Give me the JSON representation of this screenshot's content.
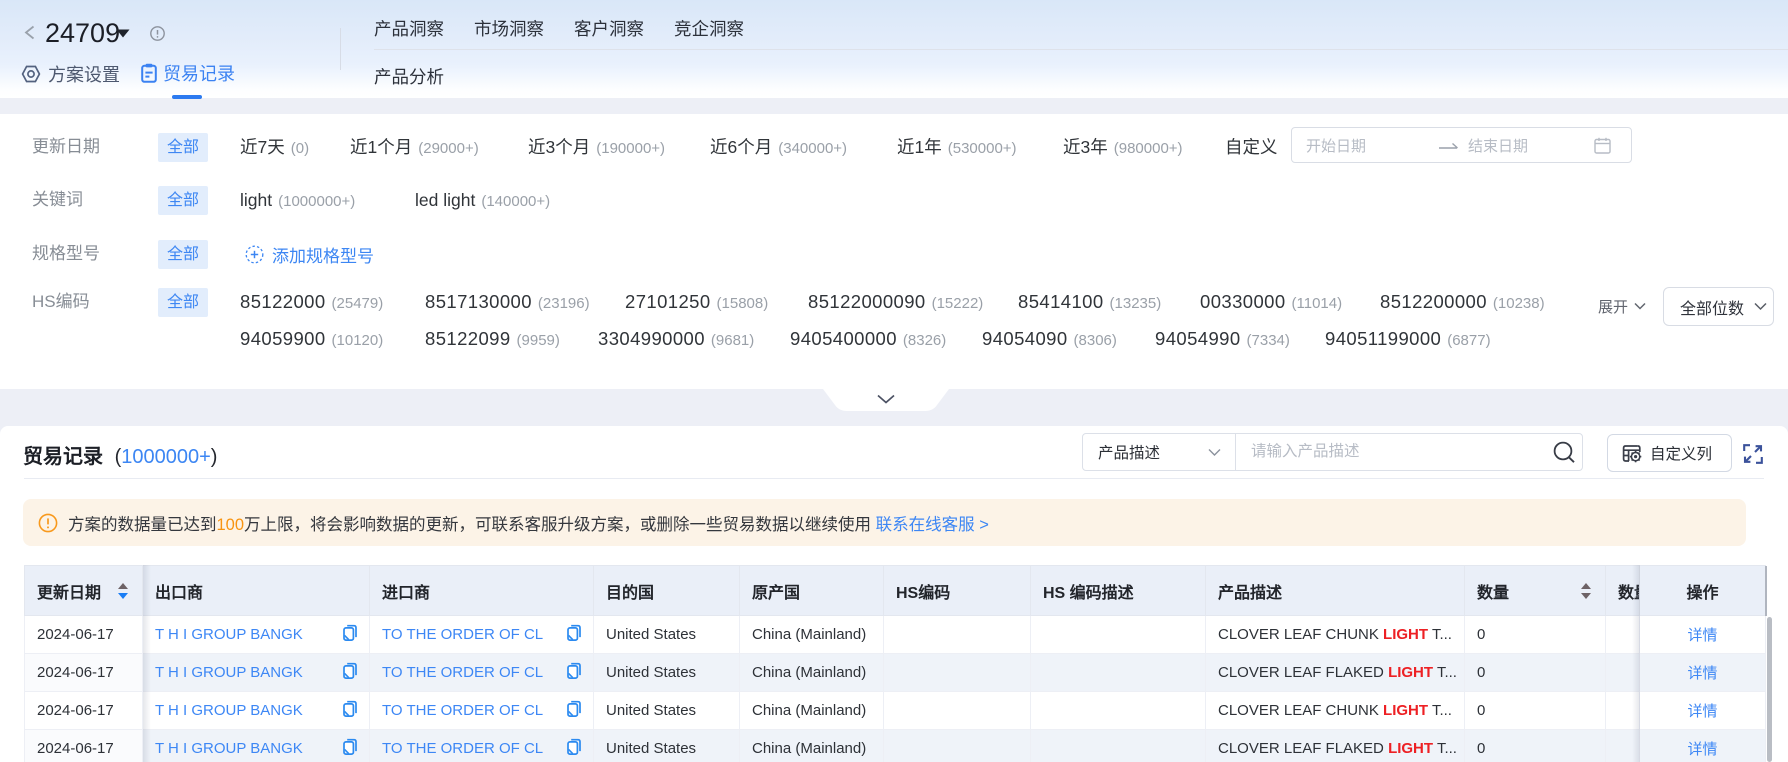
{
  "header": {
    "title": "24709",
    "tabs": {
      "settings": "方案设置",
      "records": "贸易记录"
    },
    "nav": [
      "产品洞察",
      "市场洞察",
      "客户洞察",
      "竞企洞察"
    ],
    "subnav": "产品分析"
  },
  "filters": {
    "all_label": "全部",
    "date": {
      "label": "更新日期",
      "options": [
        {
          "text": "近7天",
          "count": "(0)"
        },
        {
          "text": "近1个月",
          "count": "(29000+)"
        },
        {
          "text": "近3个月",
          "count": "(190000+)"
        },
        {
          "text": "近6个月",
          "count": "(340000+)"
        },
        {
          "text": "近1年",
          "count": "(530000+)"
        },
        {
          "text": "近3年",
          "count": "(980000+)"
        }
      ],
      "custom_label": "自定义",
      "start_placeholder": "开始日期",
      "end_placeholder": "结束日期"
    },
    "keyword": {
      "label": "关键词",
      "options": [
        {
          "text": "light",
          "count": "(1000000+)"
        },
        {
          "text": "led light",
          "count": "(140000+)"
        }
      ]
    },
    "spec": {
      "label": "规格型号",
      "add_label": "添加规格型号"
    },
    "hs": {
      "label": "HS编码",
      "line1": [
        {
          "text": "85122000",
          "count": "(25479)"
        },
        {
          "text": "8517130000",
          "count": "(23196)"
        },
        {
          "text": "27101250",
          "count": "(15808)"
        },
        {
          "text": "85122000090",
          "count": "(15222)"
        },
        {
          "text": "85414100",
          "count": "(13235)"
        },
        {
          "text": "00330000",
          "count": "(11014)"
        },
        {
          "text": "8512200000",
          "count": "(10238)"
        }
      ],
      "line2": [
        {
          "text": "94059900",
          "count": "(10120)"
        },
        {
          "text": "85122099",
          "count": "(9959)"
        },
        {
          "text": "3304990000",
          "count": "(9681)"
        },
        {
          "text": "9405400000",
          "count": "(8326)"
        },
        {
          "text": "94054090",
          "count": "(8306)"
        },
        {
          "text": "94054990",
          "count": "(7334)"
        },
        {
          "text": "94051199000",
          "count": "(6877)"
        }
      ],
      "expand_label": "展开",
      "digits_select": "全部位数"
    }
  },
  "records": {
    "title": "贸易记录",
    "count_open": "(",
    "count_value": "1000000+",
    "count_close": ")",
    "search_field": "产品描述",
    "search_placeholder": "请输入产品描述",
    "customize_columns": "自定义列",
    "notice": {
      "pre": "方案的数据量已达到",
      "highlight": "100",
      "mid": "万上限，将会影响数据的更新，可联系客服升级方案，或删除一些贸易数据以继续使用 ",
      "link": "联系在线客服 >"
    },
    "table": {
      "columns": [
        "更新日期",
        "出口商",
        "进口商",
        "目的国",
        "原产国",
        "HS编码",
        "HS 编码描述",
        "产品描述",
        "数量",
        "数量",
        "操作"
      ],
      "rows": [
        {
          "date": "2024-06-17",
          "exporter": "T H I GROUP BANGK",
          "importer": "TO THE ORDER OF CL",
          "dest": "United States",
          "origin": "China (Mainland)",
          "hs": "",
          "hs_desc": "",
          "desc_pre": "CLOVER LEAF CHUNK ",
          "desc_hl": "LIGHT",
          "desc_post": " T...",
          "qty": "0",
          "action": "详情"
        },
        {
          "date": "2024-06-17",
          "exporter": "T H I GROUP BANGK",
          "importer": "TO THE ORDER OF CL",
          "dest": "United States",
          "origin": "China (Mainland)",
          "hs": "",
          "hs_desc": "",
          "desc_pre": "CLOVER LEAF FLAKED ",
          "desc_hl": "LIGHT",
          "desc_post": " T...",
          "qty": "0",
          "action": "详情"
        },
        {
          "date": "2024-06-17",
          "exporter": "T H I GROUP BANGK",
          "importer": "TO THE ORDER OF CL",
          "dest": "United States",
          "origin": "China (Mainland)",
          "hs": "",
          "hs_desc": "",
          "desc_pre": "CLOVER LEAF CHUNK ",
          "desc_hl": "LIGHT",
          "desc_post": " T...",
          "qty": "0",
          "action": "详情"
        },
        {
          "date": "2024-06-17",
          "exporter": "T H I GROUP BANGK",
          "importer": "TO THE ORDER OF CL",
          "dest": "United States",
          "origin": "China (Mainland)",
          "hs": "",
          "hs_desc": "",
          "desc_pre": "CLOVER LEAF FLAKED ",
          "desc_hl": "LIGHT",
          "desc_post": " T...",
          "qty": "0",
          "action": "详情"
        }
      ]
    }
  }
}
